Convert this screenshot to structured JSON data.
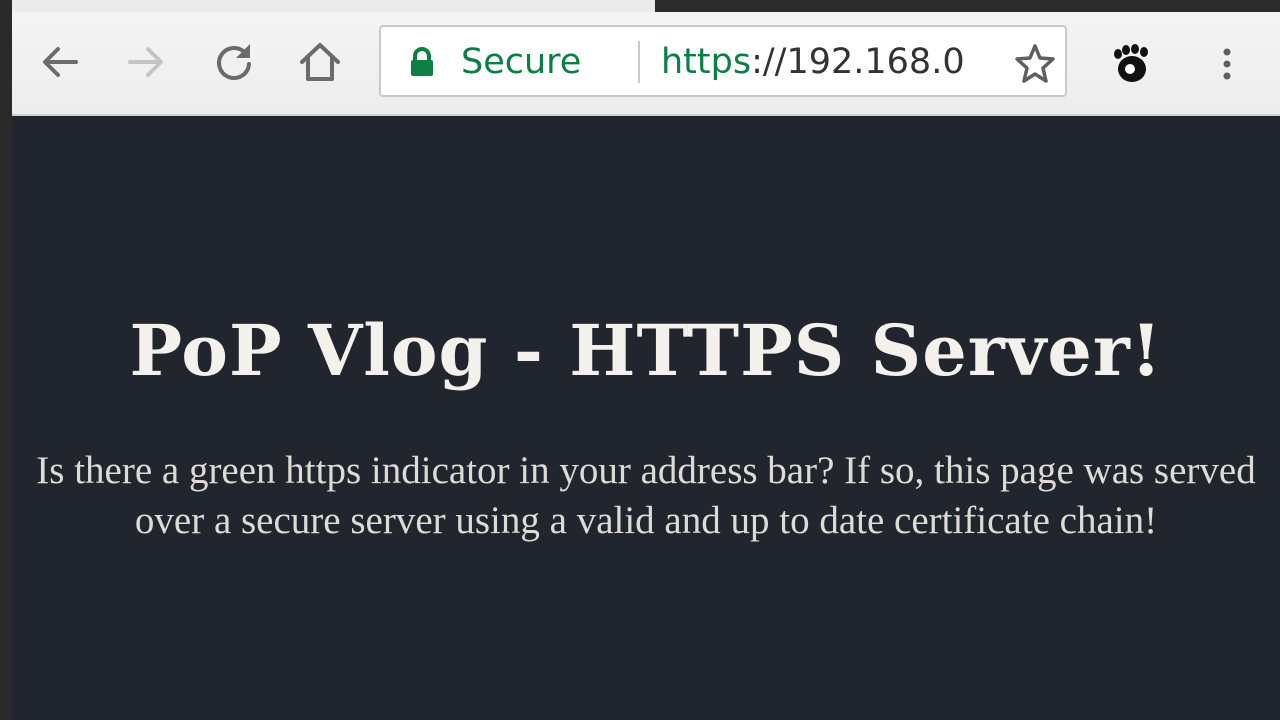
{
  "browser": {
    "nav": {
      "back_icon": "arrow-left-icon",
      "forward_icon": "arrow-right-icon",
      "reload_icon": "reload-icon",
      "home_icon": "home-icon"
    },
    "omnibox": {
      "lock_icon": "lock-icon",
      "security_label": "Secure",
      "url_scheme": "https",
      "url_rest": "://192.168.0",
      "bookmark_icon": "star-icon",
      "secure_color": "#0b8043"
    },
    "extension_icon": "gnome-foot-icon",
    "menu_icon": "more-vert-icon"
  },
  "page": {
    "heading": "PoP Vlog - HTTPS Server!",
    "message": "Is there a green https indicator in your address bar? If so, this page was served over a secure server using a valid and up to date certificate chain!",
    "background_color": "#21252d"
  }
}
